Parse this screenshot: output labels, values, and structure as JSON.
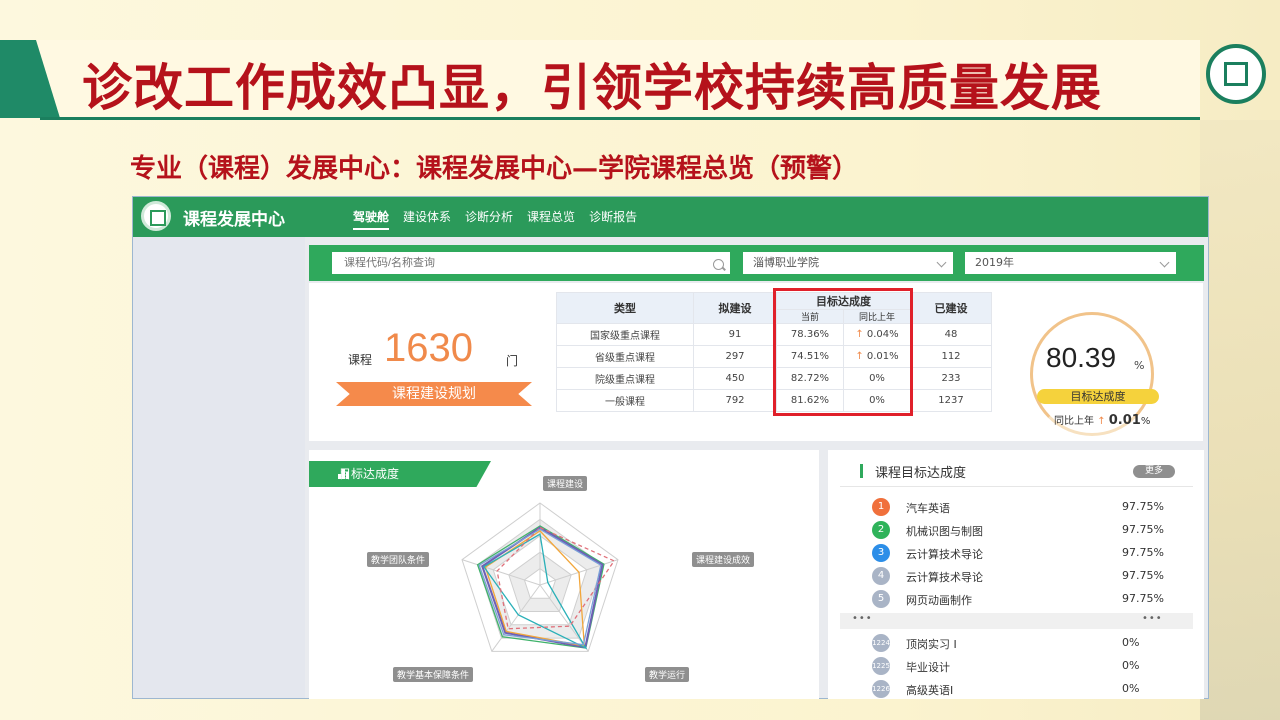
{
  "slide": {
    "title": "诊改工作成效凸显，引领学校持续高质量发展",
    "subtitle": "专业（课程）发展中心：课程发展中心—学院课程总览（预警）"
  },
  "app": {
    "title": "课程发展中心",
    "nav": [
      "驾驶舱",
      "建设体系",
      "诊断分析",
      "课程总览",
      "诊断报告"
    ],
    "search_placeholder": "课程代码/名称查询",
    "college_select": "淄博职业学院",
    "year_select": "2019年"
  },
  "summary": {
    "course_label": "课程",
    "course_count": "1630",
    "course_unit": "门",
    "plan_button": "课程建设规划"
  },
  "table": {
    "headers": {
      "type": "类型",
      "planned": "拟建设",
      "goal": "目标达成度",
      "current": "当前",
      "yoy": "同比上年",
      "built": "已建设"
    },
    "rows": [
      {
        "type": "国家级重点课程",
        "planned": "91",
        "current": "78.36%",
        "yoy_arrow": "↑",
        "yoy": "0.04%",
        "built": "48"
      },
      {
        "type": "省级重点课程",
        "planned": "297",
        "current": "74.51%",
        "yoy_arrow": "↑",
        "yoy": "0.01%",
        "built": "112"
      },
      {
        "type": "院级重点课程",
        "planned": "450",
        "current": "82.72%",
        "yoy_arrow": "",
        "yoy": "0%",
        "built": "233"
      },
      {
        "type": "一般课程",
        "planned": "792",
        "current": "81.62%",
        "yoy_arrow": "",
        "yoy": "0%",
        "built": "1237"
      }
    ]
  },
  "gauge": {
    "value": "80.39",
    "pct": "%",
    "label": "目标达成度",
    "yoy_label": "同比上年",
    "yoy_arrow": "↑",
    "yoy_value": "0.01",
    "yoy_pct": "%"
  },
  "radar": {
    "tab_label": "目标达成度",
    "axes": [
      "课程建设",
      "课程建设成效",
      "教学运行",
      "教学基本保障条件",
      "教学团队条件"
    ],
    "colors": [
      "#3fb26a",
      "#6e5fb5",
      "#f2a63a",
      "#2ab0b8",
      "#e0707a",
      "#7aa1d8"
    ]
  },
  "list": {
    "title": "课程目标达成度",
    "more": "更多",
    "top": [
      {
        "rank": "1",
        "name": "汽车英语",
        "value": "97.75%",
        "color": "#f0703c"
      },
      {
        "rank": "2",
        "name": "机械识图与制图",
        "value": "97.75%",
        "color": "#2fb35a"
      },
      {
        "rank": "3",
        "name": "云计算技术导论",
        "value": "97.75%",
        "color": "#2c8ee8"
      },
      {
        "rank": "4",
        "name": "云计算技术导论",
        "value": "97.75%",
        "color": "#a9b4c6"
      },
      {
        "rank": "5",
        "name": "网页动画制作",
        "value": "97.75%",
        "color": "#a9b4c6"
      }
    ],
    "dots": "•••",
    "bottom": [
      {
        "rank": "1224",
        "name": "顶岗实习 I",
        "value": "0%"
      },
      {
        "rank": "1225",
        "name": "毕业设计",
        "value": "0%"
      },
      {
        "rank": "1226",
        "name": "高级英语I",
        "value": "0%"
      }
    ]
  }
}
